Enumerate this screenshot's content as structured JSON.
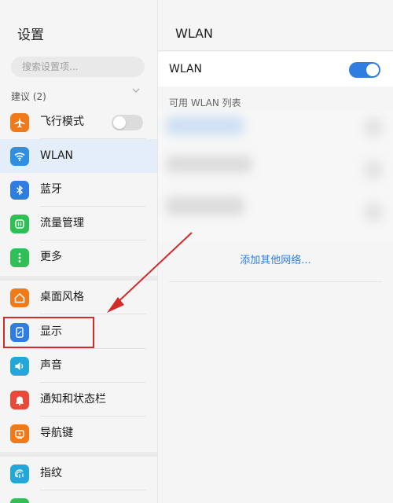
{
  "left": {
    "title": "设置",
    "search_placeholder": "搜索设置项...",
    "section_label": "建议 (2)",
    "items": [
      {
        "label": "飞行模式",
        "icon": "airplane-icon",
        "color": "#f07a1a"
      },
      {
        "label": "WLAN",
        "icon": "wifi-icon",
        "color": "#2f8fe0",
        "selected": true
      },
      {
        "label": "蓝牙",
        "icon": "bluetooth-icon",
        "color": "#2f7de1"
      },
      {
        "label": "流量管理",
        "icon": "data-usage-icon",
        "color": "#2fbf55"
      },
      {
        "label": "更多",
        "icon": "more-icon",
        "color": "#2fbf55"
      },
      {
        "label": "桌面风格",
        "icon": "home-icon",
        "color": "#f07a1a"
      },
      {
        "label": "显示",
        "icon": "display-icon",
        "color": "#2f7de1"
      },
      {
        "label": "声音",
        "icon": "sound-icon",
        "color": "#22a7d8"
      },
      {
        "label": "通知和状态栏",
        "icon": "bell-icon",
        "color": "#e84a3a"
      },
      {
        "label": "导航键",
        "icon": "navigation-icon",
        "color": "#f07a1a"
      },
      {
        "label": "指纹",
        "icon": "fingerprint-icon",
        "color": "#22a7d8"
      }
    ]
  },
  "right": {
    "title": "WLAN",
    "wlan_label": "WLAN",
    "wlan_on": true,
    "list_header": "可用 WLAN 列表",
    "add_network": "添加其他网络..."
  },
  "annotation": {
    "color": "#d42a2a",
    "target": "显示"
  }
}
